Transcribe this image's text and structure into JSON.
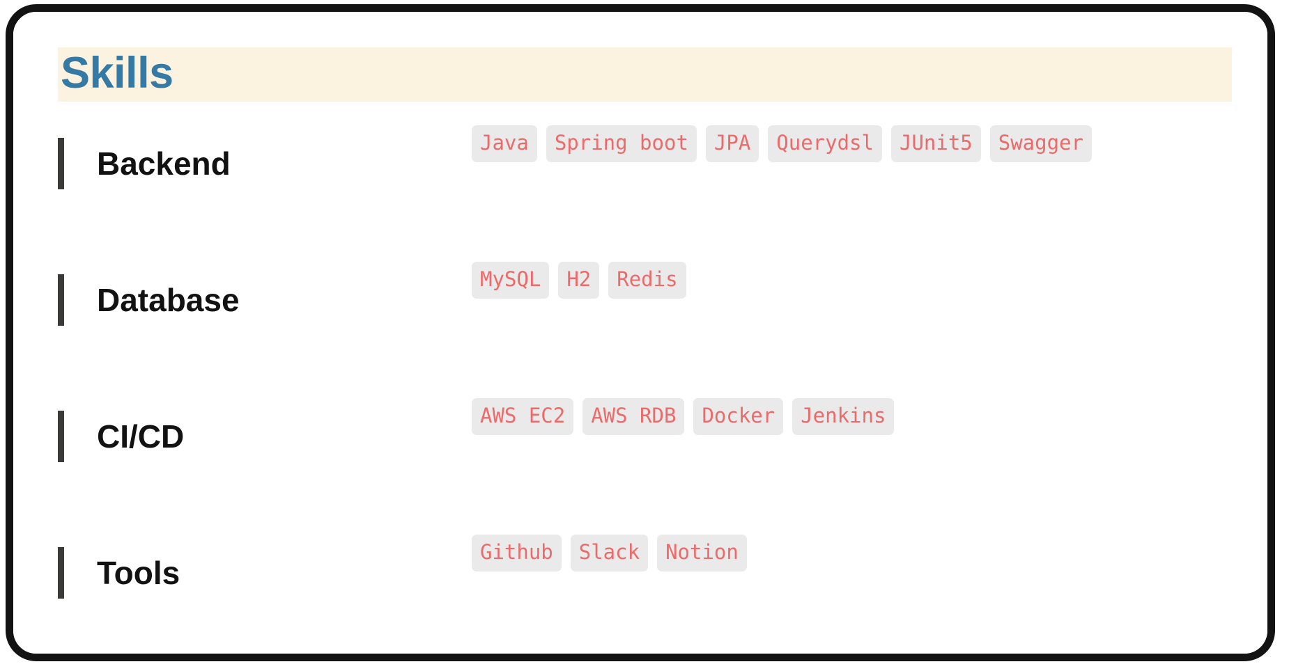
{
  "card": {
    "heading": "Skills",
    "heading_color": "#3579A5",
    "heading_band_color": "#FBF2DF",
    "accent_bar_color": "#3a3a38",
    "tag_bg_color": "#ebeaea",
    "tag_text_color": "#ED6A6A"
  },
  "skill_groups": [
    {
      "label": "Backend",
      "tags": [
        "Java",
        "Spring boot",
        "JPA",
        "Querydsl",
        "JUnit5",
        "Swagger"
      ]
    },
    {
      "label": "Database",
      "tags": [
        "MySQL",
        "H2",
        "Redis"
      ]
    },
    {
      "label": "CI/CD",
      "tags": [
        "AWS EC2",
        "AWS RDB",
        "Docker",
        "Jenkins"
      ]
    },
    {
      "label": "Tools",
      "tags": [
        "Github",
        "Slack",
        "Notion"
      ]
    }
  ]
}
